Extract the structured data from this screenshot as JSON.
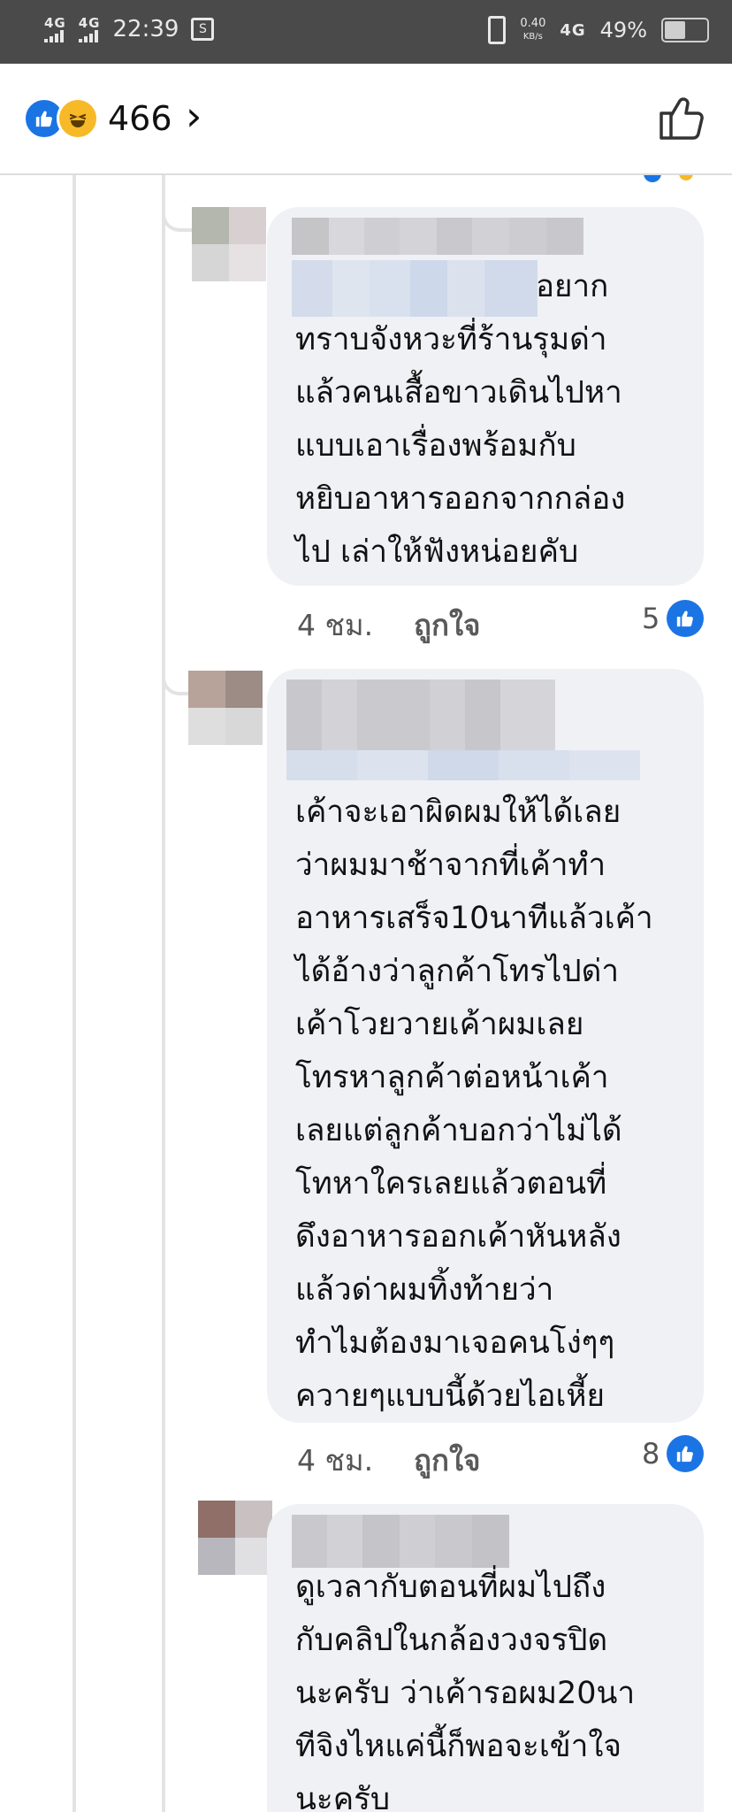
{
  "status_bar": {
    "network_left_1": "4G",
    "network_left_2": "4G",
    "time": "22:39",
    "data_speed": "0.40",
    "data_unit": "KB/s",
    "network_right": "4G",
    "battery": "49%"
  },
  "header": {
    "reaction_count": "466",
    "reactions": [
      "like-icon",
      "haha-icon"
    ],
    "chevron": "›"
  },
  "comments": [
    {
      "text_line1_suffix": "อยาก",
      "text_lines": "ทราบจังหวะที่ร้านรุมด่า\nแล้วคนเสื้อขาวเดินไปหา\nแบบเอาเรื่องพร้อมกับ\nหยิบอาหารออกจากกล่อง\nไป เล่าให้ฟังหน่อยคับ",
      "time": "4 ชม.",
      "like_label": "ถูกใจ",
      "reaction_count": "5"
    },
    {
      "text_lines": "เค้าจะเอาผิดผมให้ได้เลย\nว่าผมมาช้าจากที่เค้าทำ\nอาหารเสร็จ10นาทีแล้วเค้า\nได้อ้างว่าลูกค้าโทรไปด่า\nเค้าโวยวายเค้าผมเลย\nโทรหาลูกค้าต่อหน้าเค้า\nเลยแต่ลูกค้าบอกว่าไม่ได้\nโทหาใครเลยแล้วตอนที่\nดึงอาหารออกเค้าหันหลัง\nแล้วด่าผมทิ้งท้ายว่า\nทำไมต้องมาเจอคนโง่ๆๆ\nควายๆแบบนี้ด้วยไอเหี้ย",
      "time": "4 ชม.",
      "like_label": "ถูกใจ",
      "reaction_count": "8"
    },
    {
      "text_lines": "ดูเวลากับตอนที่ผมไปถึง\nกับคลิปในกล้องวงจรปิด\nนะครับ ว่าเค้ารอผม20นา\nทีจิงไหแค่นี้ก็พอจะเข้าใจ\nนะครับ"
    }
  ],
  "colors": {
    "accent": "#1b74e4",
    "bubble": "#f0f1f5",
    "status_bg": "#4a4a4a"
  }
}
